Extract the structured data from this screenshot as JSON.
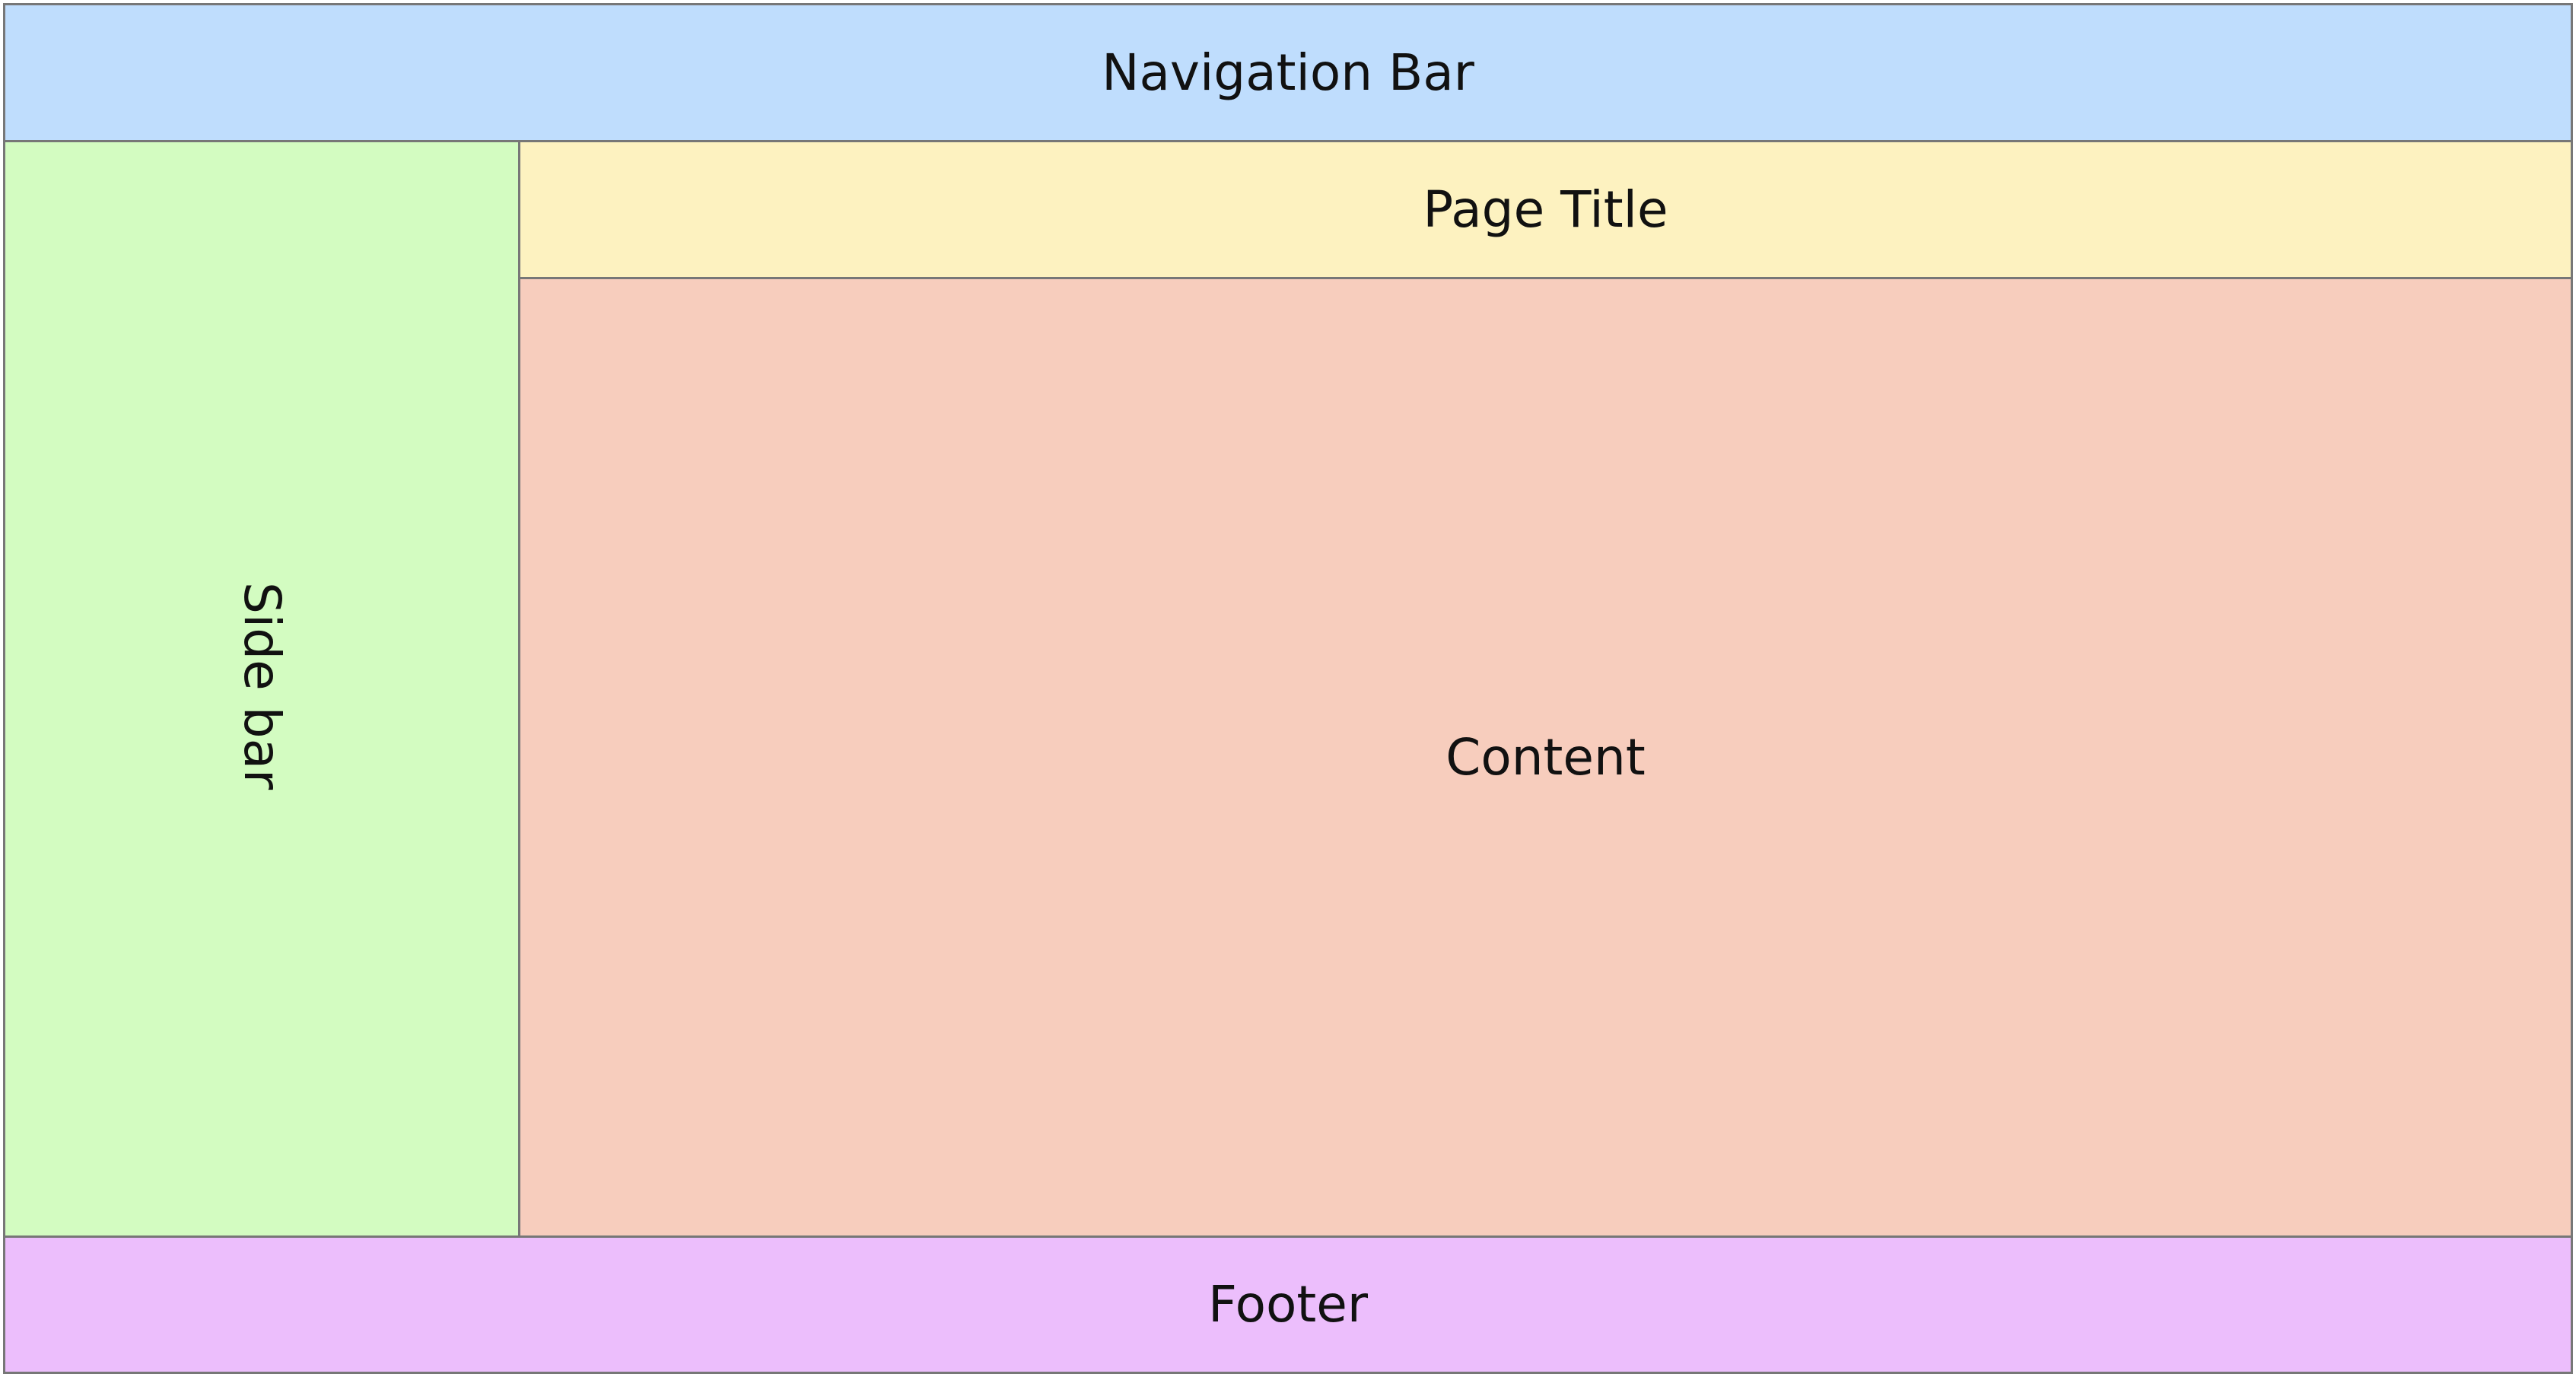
{
  "layout": {
    "navigation_bar": {
      "label": "Navigation Bar",
      "color": "#BFDDFD"
    },
    "side_bar": {
      "label": "Side bar",
      "color": "#D3FCC1"
    },
    "page_title": {
      "label": "Page Title",
      "color": "#FDF2C0"
    },
    "content": {
      "label": "Content",
      "color": "#F7CDBD"
    },
    "footer": {
      "label": "Footer",
      "color": "#ECBEFC"
    },
    "border_color": "#777777"
  }
}
